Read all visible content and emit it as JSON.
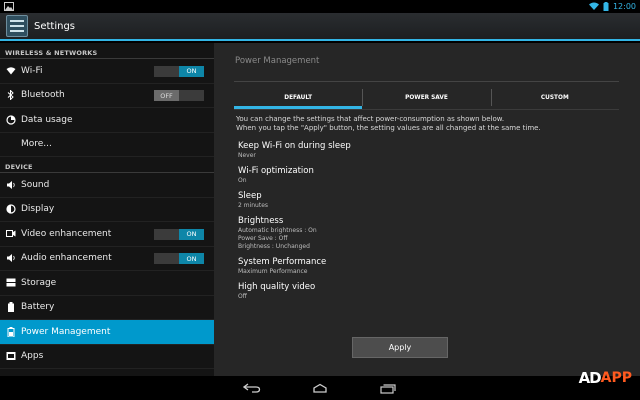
{
  "statusbar": {
    "time": "12:00"
  },
  "actionbar": {
    "title": "Settings"
  },
  "sidebar": {
    "wireless_header": "WIRELESS & NETWORKS",
    "device_header": "DEVICE",
    "items": [
      {
        "label": "Wi-Fi",
        "icon": "wifi-icon",
        "toggle": "ON"
      },
      {
        "label": "Bluetooth",
        "icon": "bluetooth-icon",
        "toggle": "OFF"
      },
      {
        "label": "Data usage",
        "icon": "data-usage-icon"
      },
      {
        "label": "More..."
      },
      {
        "label": "Sound",
        "icon": "speaker-icon"
      },
      {
        "label": "Display",
        "icon": "brightness-icon"
      },
      {
        "label": "Video enhancement",
        "icon": "video-icon",
        "toggle": "ON"
      },
      {
        "label": "Audio enhancement",
        "icon": "audio-icon",
        "toggle": "ON"
      },
      {
        "label": "Storage",
        "icon": "storage-icon"
      },
      {
        "label": "Battery",
        "icon": "battery-icon"
      },
      {
        "label": "Power Management",
        "icon": "power-icon",
        "selected": true
      },
      {
        "label": "Apps",
        "icon": "apps-icon"
      }
    ]
  },
  "main": {
    "title": "Power Management",
    "tabs": [
      {
        "label": "DEFAULT",
        "active": true
      },
      {
        "label": "POWER SAVE"
      },
      {
        "label": "CUSTOM"
      }
    ],
    "description_line1": "You can change the settings that affect power-consumption as shown below.",
    "description_line2": "When you tap the \"Apply\" button, the setting values are all changed at the same time.",
    "settings": [
      {
        "title": "Keep Wi-Fi on during sleep",
        "summary": [
          "Never"
        ]
      },
      {
        "title": "Wi-Fi optimization",
        "summary": [
          "On"
        ]
      },
      {
        "title": "Sleep",
        "summary": [
          "2 minutes"
        ]
      },
      {
        "title": "Brightness",
        "summary": [
          "Automatic brightness : On",
          "Power Save : Off",
          "Brightness : Unchanged"
        ]
      },
      {
        "title": "System Performance",
        "summary": [
          "Maximum Performance"
        ]
      },
      {
        "title": "High quality video",
        "summary": [
          "Off"
        ]
      }
    ],
    "apply_label": "Apply"
  },
  "watermark": {
    "ad": "AD",
    "app": "APP"
  },
  "colors": {
    "accent": "#33b5e5",
    "selected": "#0099cc",
    "watermark": "#ff5a1f"
  }
}
